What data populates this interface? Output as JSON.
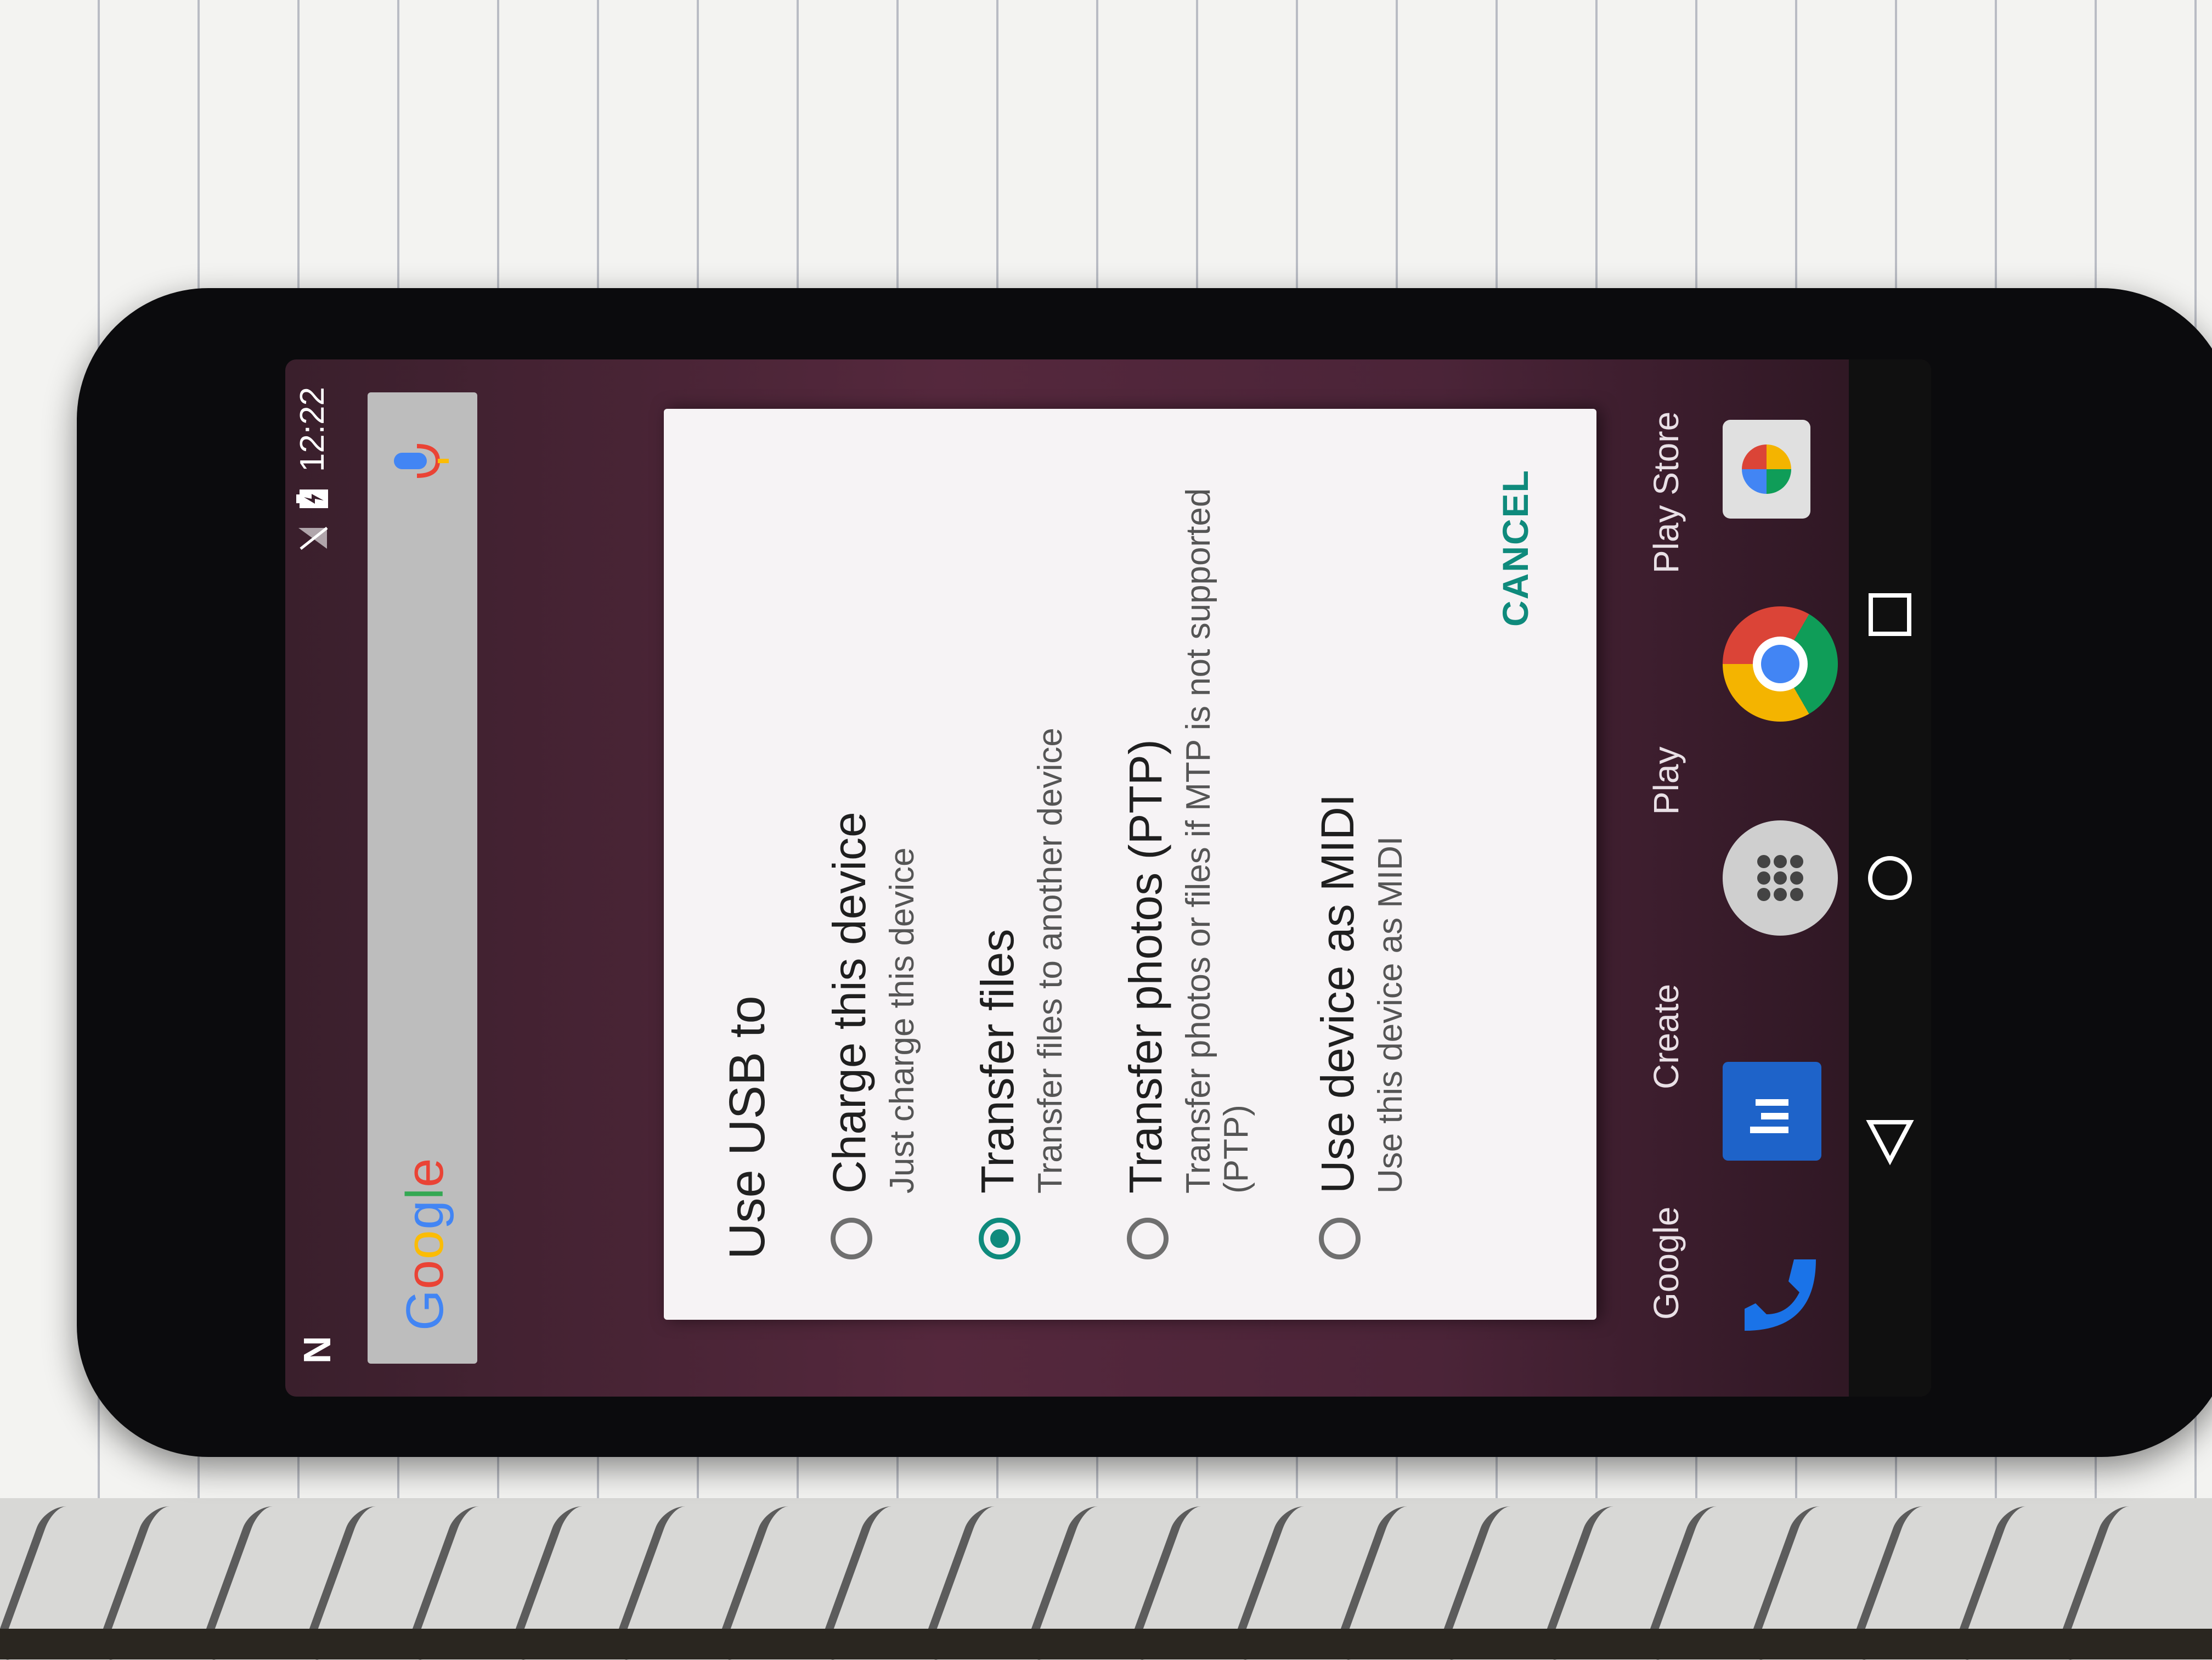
{
  "status_bar": {
    "time": "12:22",
    "left_icon": "n-notification-icon",
    "icons": [
      "no-sim-icon",
      "battery-charging-icon"
    ]
  },
  "search": {
    "logo": "Google",
    "mic_icon": "mic-icon"
  },
  "dialog": {
    "title": "Use USB to",
    "options": [
      {
        "title": "Charge this device",
        "subtitle": "Just charge this device",
        "selected": false
      },
      {
        "title": "Transfer files",
        "subtitle": "Transfer files to another device",
        "selected": true
      },
      {
        "title": "Transfer photos (PTP)",
        "subtitle": "Transfer photos or files if MTP is not supported (PTP)",
        "selected": false
      },
      {
        "title": "Use device as MIDI",
        "subtitle": "Use this device as MIDI",
        "selected": false
      }
    ],
    "cancel_label": "CANCEL",
    "accent_color": "#0f8a7c"
  },
  "home": {
    "labels": [
      "Google",
      "Create",
      "Play",
      "Play Store"
    ],
    "dock": [
      "phone-icon",
      "messages-icon",
      "app-drawer-icon",
      "chrome-icon",
      "camera-icon"
    ]
  },
  "nav": [
    "back-icon",
    "home-icon",
    "recents-icon"
  ]
}
